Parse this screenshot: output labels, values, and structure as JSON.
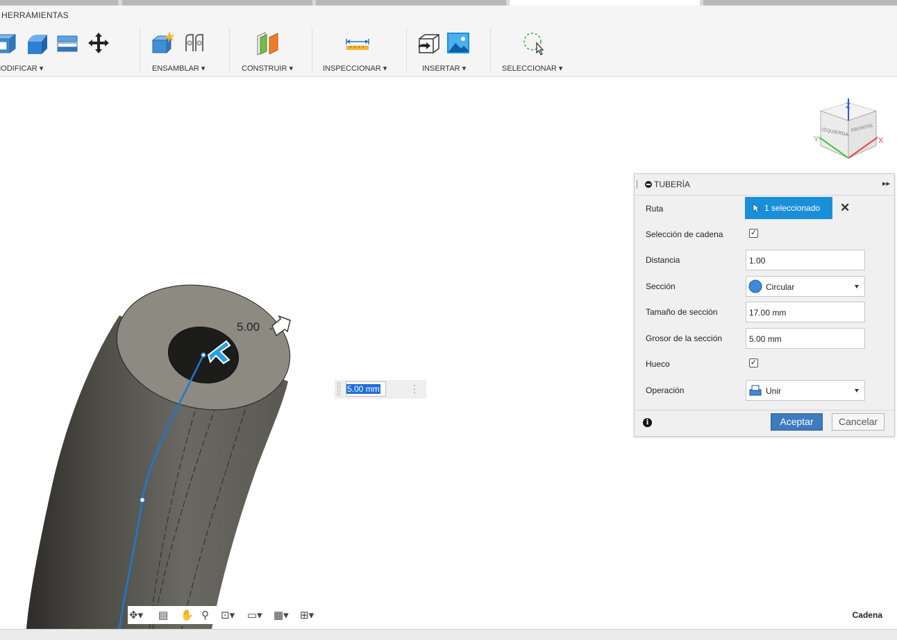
{
  "toolbar": {
    "title": "HERRAMIENTAS",
    "groups": [
      {
        "label": "MODIFICAR ▾"
      },
      {
        "label": "ENSAMBLAR ▾"
      },
      {
        "label": "CONSTRUIR ▾"
      },
      {
        "label": "INSPECCIONAR ▾"
      },
      {
        "label": "INSERTAR ▾"
      },
      {
        "label": "SELECCIONAR ▾"
      }
    ]
  },
  "viewcube": {
    "top": "Z",
    "left_face": "IZQUIERDA",
    "front_face": "FRONTAL",
    "x_axis": "X",
    "y_axis": "Y"
  },
  "canvas": {
    "dimension_label": "5.00"
  },
  "float_input": {
    "value": "5.00 mm"
  },
  "dialog": {
    "title": "TUBERÍA",
    "rows": {
      "ruta": {
        "label": "Ruta",
        "value": "1 seleccionado"
      },
      "cadena": {
        "label": "Selección de cadena",
        "checked": "✓"
      },
      "distancia": {
        "label": "Distancia",
        "value": "1.00"
      },
      "seccion": {
        "label": "Sección",
        "value": "Circular"
      },
      "tamano": {
        "label": "Tamaño de sección",
        "value": "17.00 mm"
      },
      "grosor": {
        "label": "Grosor de la sección",
        "value": "5.00 mm"
      },
      "hueco": {
        "label": "Hueco",
        "checked": "✓"
      },
      "operacion": {
        "label": "Operación",
        "value": "Unir"
      }
    },
    "ok_label": "Aceptar",
    "cancel_label": "Cancelar",
    "info_glyph": "i"
  },
  "status": {
    "mode": "Cadena"
  },
  "colors": {
    "accent": "#1a8fd9",
    "ok_button": "#3d7ac0",
    "path_line": "#1f78d1",
    "tube_body": "#5f5d55",
    "tube_face": "#8d8a82"
  }
}
